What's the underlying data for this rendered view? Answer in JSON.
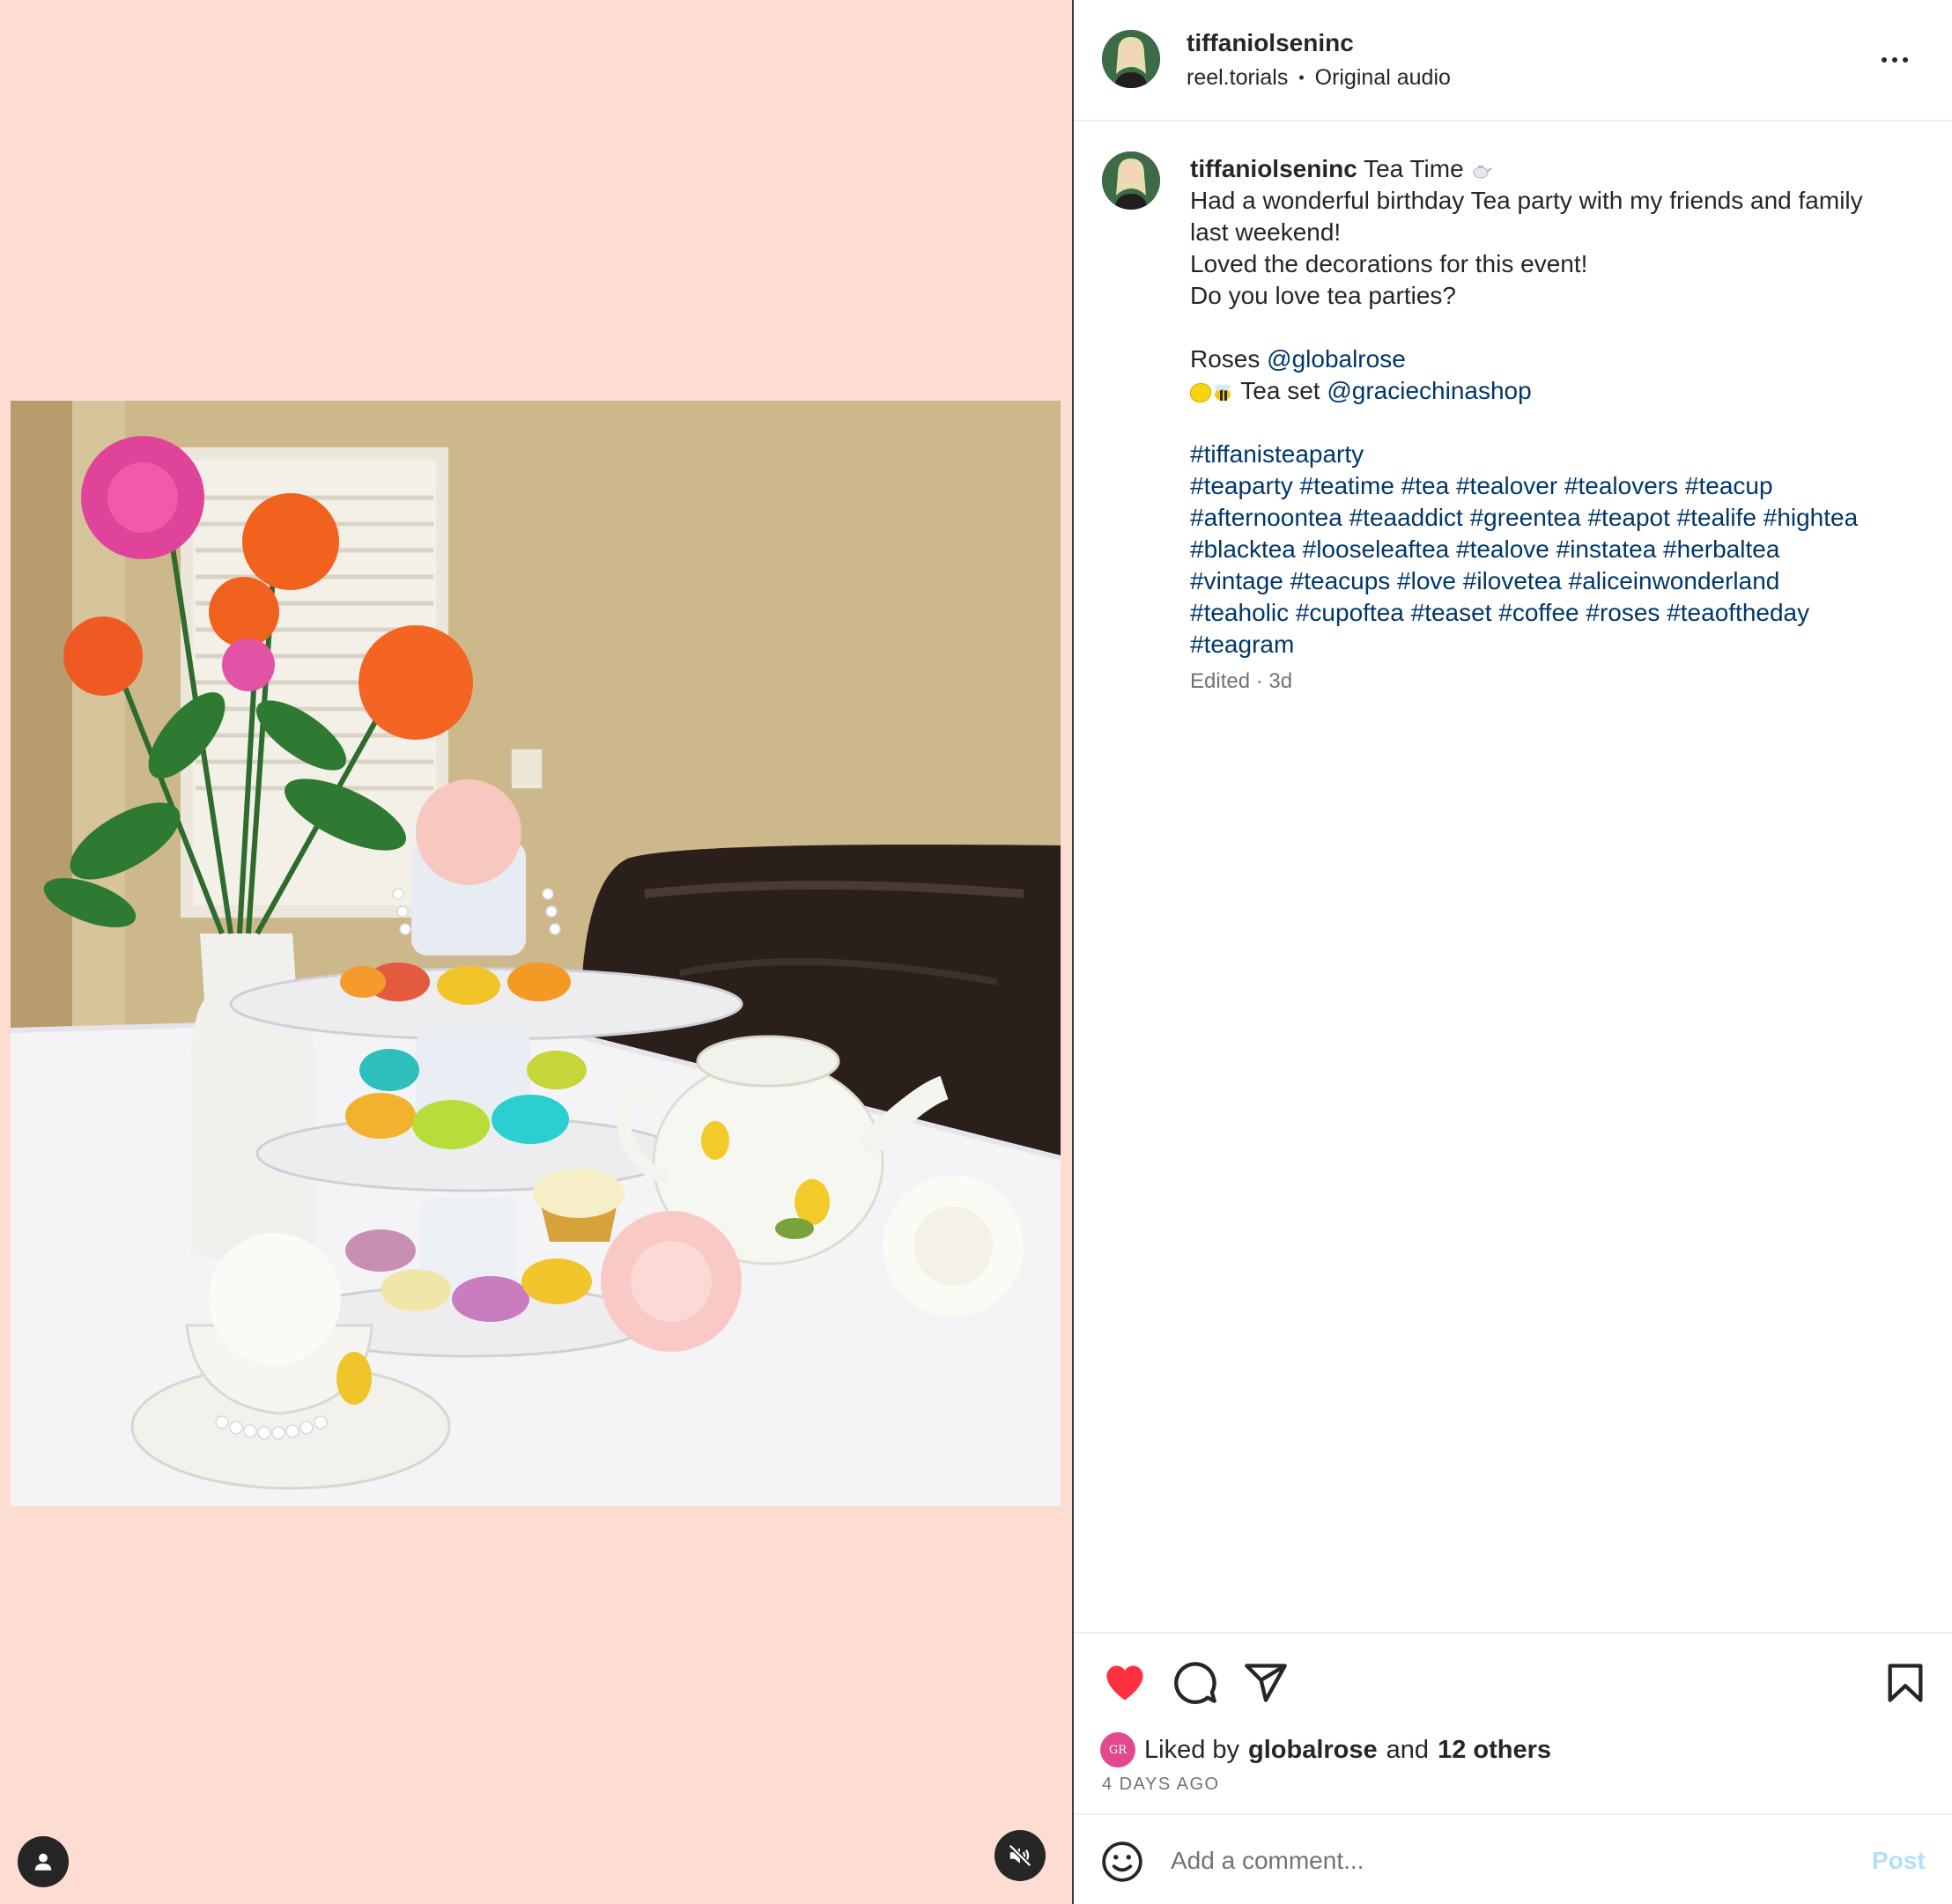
{
  "header": {
    "username": "tiffaniolseninc",
    "audio_account": "reel.torials",
    "audio_separator": "•",
    "audio_label": "Original audio"
  },
  "caption": {
    "username": "tiffaniolseninc",
    "title": "Tea Time",
    "lines": [
      "Had a wonderful birthday Tea party with my friends and family",
      "last weekend!",
      "Loved the decorations for this event!",
      "Do you love tea parties?"
    ],
    "roses_label": "Roses",
    "roses_mention": "@globalrose",
    "teaset_label": "Tea set",
    "teaset_mention": "@graciechinashop",
    "hashtag_lines": [
      "#tiffanisteaparty",
      "#teaparty #teatime #tea #tealover #tealovers #teacup",
      "#afternoontea #teaaddict #greentea #teapot #tealife #hightea",
      "#blacktea #looseleaftea #tealove #instatea #herbaltea",
      "#vintage #teacups #love #ilovetea #aliceinwonderland",
      "#teaholic #cupoftea #teaset #coffee #roses #teaoftheday",
      "#teagram"
    ],
    "meta": "Edited · 3d"
  },
  "likes": {
    "prefix": "Liked by",
    "user": "globalrose",
    "conjunction": "and",
    "others": "12 others",
    "liker_initials": "GR",
    "time_ago": "4 DAYS AGO"
  },
  "comment": {
    "placeholder": "Add a comment...",
    "post_label": "Post"
  },
  "icons": {
    "like": "heart-filled-icon",
    "comment": "speech-bubble-icon",
    "share": "paper-plane-icon",
    "save": "bookmark-icon",
    "more": "more-horizontal-icon",
    "mute": "speaker-muted-icon",
    "tags": "user-tag-icon",
    "emoji": "smiley-icon"
  },
  "colors": {
    "media_background": "#fddcd2",
    "like_red": "#ff3040",
    "link_blue": "#00376b",
    "post_disabled": "#b2dffc",
    "secondary_text": "#737373"
  }
}
